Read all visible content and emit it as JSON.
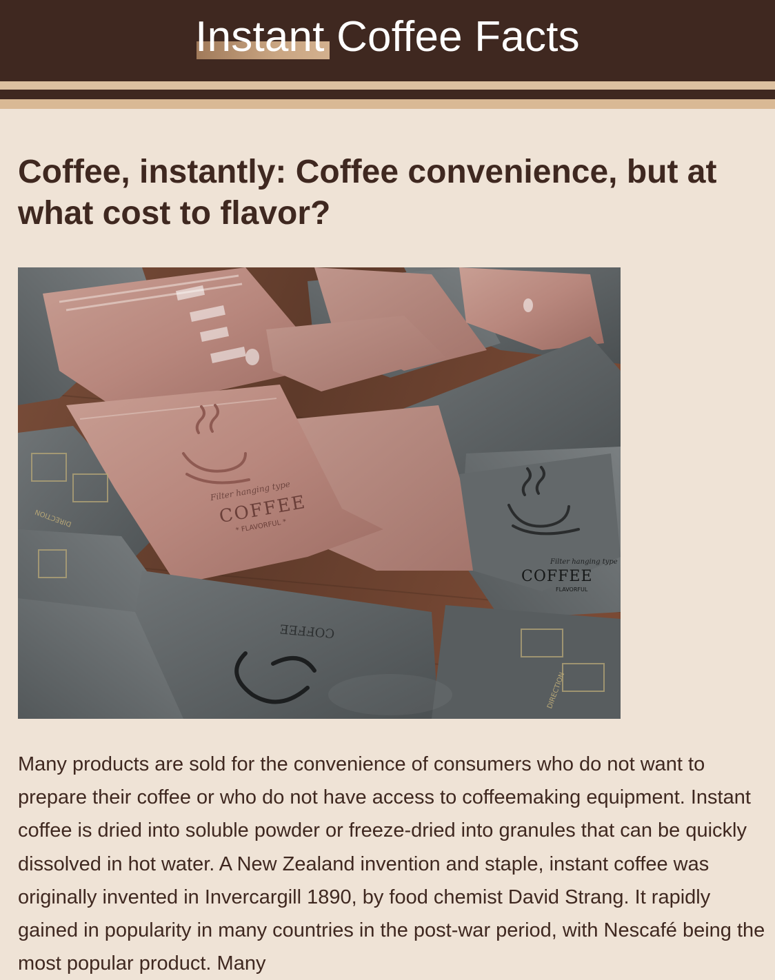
{
  "header": {
    "title": "Instant Coffee Facts"
  },
  "article": {
    "heading": "Coffee, instantly: Coffee convenience, but at what cost to flavor?",
    "image": {
      "subject": "coffee-pouches-photo",
      "pouch_labels": [
        "COFFEE",
        "FLAVORFUL",
        "Filter hanging type",
        "DIRECTION"
      ]
    },
    "body": "Many products are sold for the convenience of consumers who do not want to prepare their coffee or who do not have access to coffeemaking equipment. Instant coffee is dried into soluble powder or freeze-dried into granules that can be quickly dissolved in hot water. A New Zealand invention and staple, instant coffee was originally invented in Invercargill 1890, by food chemist David Strang. It rapidly gained in popularity in many countries in the post-war period, with Nescafé being the most popular product. Many"
  },
  "colors": {
    "header_bg": "#3f2820",
    "page_bg": "#efe3d6",
    "accent_tan": "#d9b995",
    "text": "#3f2820",
    "pink_pouch": "#b88a80",
    "gray_pouch": "#5f6466",
    "wood": "#6a4432"
  }
}
